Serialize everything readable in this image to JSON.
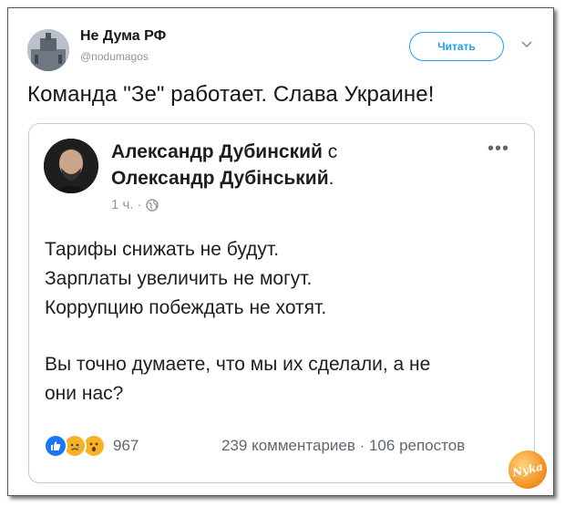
{
  "tweet": {
    "account_name": "Не Дума РФ",
    "handle": "@nodumagos",
    "follow_label": "Читать",
    "text": "Команда \"Зе\" работает. Слава Украине!"
  },
  "embedded_post": {
    "author_ru": "Александр Дубинский",
    "connector": " с",
    "author_ua": "Олександр Дубінський",
    "author_ua_suffix": ".",
    "time": "1 ч. ·",
    "more_dots": "•••",
    "body_lines": [
      "Тарифы снижать не будут.",
      "Зарплаты увеличить не могут.",
      "Коррупцию побеждать не хотят.",
      "Вы точно думаете, что мы их сделали, а не",
      "они нас?"
    ],
    "reactions": [
      "like-icon",
      "sad-icon",
      "wow-icon"
    ],
    "reaction_count": "967",
    "comments_and_shares": "239 комментариев · 106 репостов"
  },
  "watermark_text": "Nyka",
  "colors": {
    "twitter_blue": "#1da1f2",
    "fb_like_blue": "#1877f2",
    "reaction_yellow": "#f7b125"
  }
}
